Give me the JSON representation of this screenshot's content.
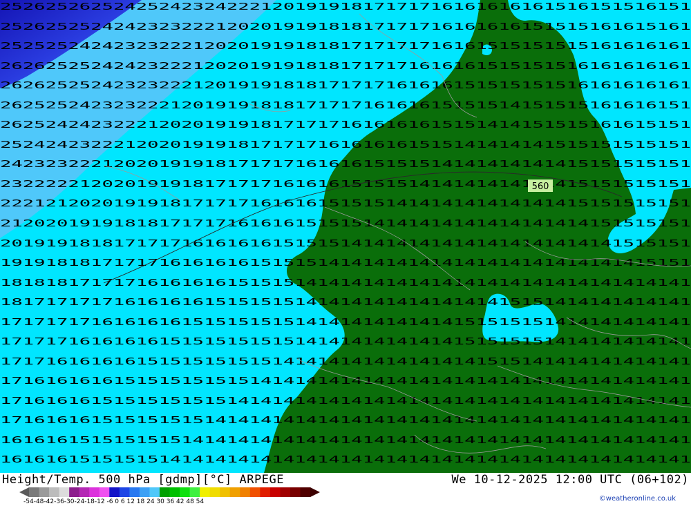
{
  "map": {
    "contour_label": "560",
    "colors": {
      "cold_blue": "#1e1ed8",
      "blue": "#3a46e6",
      "light_blue": "#2ea0f0",
      "cyan": "#00e6ff",
      "green": "#0a6e0a",
      "contour_label_bg": "#c8f0a0",
      "borders": "#9a9a9a"
    },
    "value_rows": [
      "2526252625242524232422212019191817171716161616161516151516151",
      "2526252524242323222120201919181817171716161616151515161615161",
      "2525252424232322212020191918181717171716161515151515161616161",
      "2626252524242322212020191918181717171616161515151516161616161",
      "2626252524232322212019191818171717161616151515151516161616161",
      "2625252423232221201919181817171716161615151514151515161616151",
      "2625242423222120201919181717171616161615151414151515161615151",
      "2524242322212020191918171717161616161515141414141515151515151",
      "2423232221202019191817171716161615151514141414141415151515151",
      "2322222120201919181717171616161515151414141414141415151515151",
      "2221212020191918171717161616151515141414141414141415151515151",
      "2120201919181817171716161615151514141414141414141414151515151",
      "2019191818171717161616161515151414141414141414141414141515151",
      "1919181817171716161616151515141414141414141414141414141415151",
      "1818181717171616161615151514141414141414141414141414141414141",
      "1817171717161616161515151514141414141414141415151414141414141",
      "1717171716161616151515151514141414141414151515151414141414141",
      "1717171616161615151515151514141414141414151515151414141414141",
      "1717161616161515151515151414141414141414141515141414141414141",
      "1716161616151515151515141414141414141414141414141414141414141",
      "1716161615151515151514141414141414141414141414141414141414141",
      "1716161615151515151414141414141414141414141414141414141414141",
      "1616161515151515141414141414141414141414141414141414141414141",
      "1616161515151514141414141414141414141414141414141414141414141"
    ]
  },
  "footer": {
    "title_left": "Height/Temp. 500 hPa [gdmp][°C] ARPEGE",
    "title_right": "We 10-12-2025 12:00 UTC (06+102)",
    "credit": "©weatheronline.co.uk",
    "legend_ticks": "-54-48-42-36-30-24-18-12 -6  0  6  12  18  24  30  36  42  48  54",
    "legend_colors": [
      "#7a7a7a",
      "#9a9a9a",
      "#bcbcbc",
      "#dcdcdc",
      "#8c1e8c",
      "#b428b4",
      "#dc32dc",
      "#f050f0",
      "#1414c8",
      "#1e46e6",
      "#2878f0",
      "#3ca0f5",
      "#50c8fa",
      "#00a000",
      "#00c000",
      "#10e010",
      "#40f040",
      "#f0f000",
      "#f0dc00",
      "#f0c000",
      "#f0a000",
      "#f08000",
      "#f05000",
      "#e01e00",
      "#c80000",
      "#a00000",
      "#780000",
      "#500000"
    ]
  }
}
